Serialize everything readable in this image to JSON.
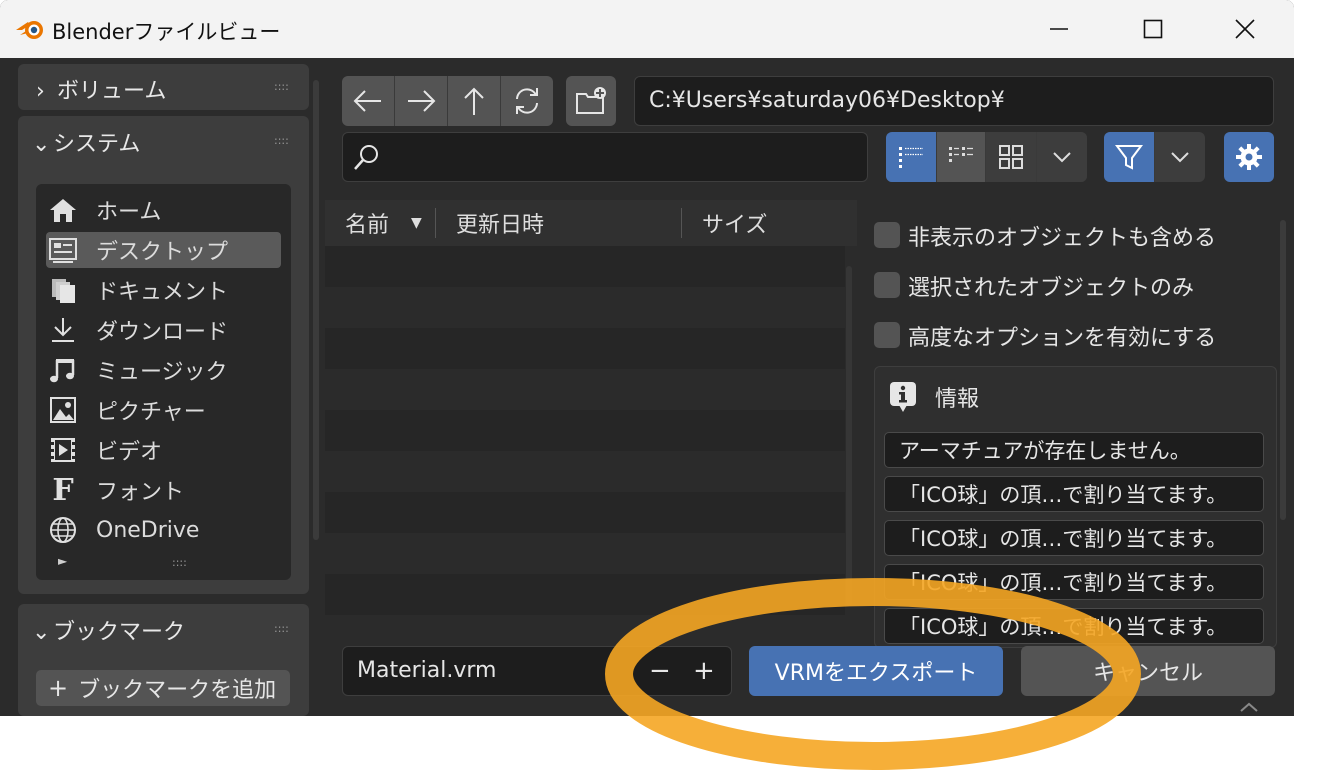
{
  "window": {
    "title": "Blenderファイルビュー"
  },
  "sidebar": {
    "volumes_label": "ボリューム",
    "system_label": "システム",
    "grip": "::::",
    "places": [
      {
        "label": "ホーム",
        "icon": "home-icon"
      },
      {
        "label": "デスクトップ",
        "icon": "desktop-icon",
        "selected": true
      },
      {
        "label": "ドキュメント",
        "icon": "documents-icon"
      },
      {
        "label": "ダウンロード",
        "icon": "download-icon"
      },
      {
        "label": "ミュージック",
        "icon": "music-icon"
      },
      {
        "label": "ピクチャー",
        "icon": "pictures-icon"
      },
      {
        "label": "ビデオ",
        "icon": "video-icon"
      },
      {
        "label": "フォント",
        "icon": "font-icon"
      },
      {
        "label": "OneDrive",
        "icon": "globe-icon"
      }
    ],
    "bookmarks_label": "ブックマーク",
    "add_bookmark_label": "ブックマークを追加"
  },
  "toolbar": {
    "path": "C:¥Users¥saturday06¥Desktop¥",
    "search_placeholder": ""
  },
  "file_list": {
    "col_name": "名前",
    "col_date": "更新日時",
    "col_size": "サイズ"
  },
  "options": {
    "include_hidden": "非表示のオブジェクトも含める",
    "selected_only": "選択されたオブジェクトのみ",
    "advanced": "高度なオプションを有効にする",
    "info_title": "情報",
    "messages": [
      "アーマチュアが存在しません。",
      "「ICO球」の頂…で割り当てます。",
      "「ICO球」の頂…で割り当てます。",
      "「ICO球」の頂…で割り当てます。",
      "「ICO球」の頂…で割り当てます。"
    ]
  },
  "footer": {
    "filename": "Material.vrm",
    "minus": "−",
    "plus": "+",
    "export_label": "VRMをエクスポート",
    "cancel_label": "キャンセル"
  },
  "colors": {
    "accent_blue": "#4772b3",
    "highlight_ring": "#f5a623"
  }
}
